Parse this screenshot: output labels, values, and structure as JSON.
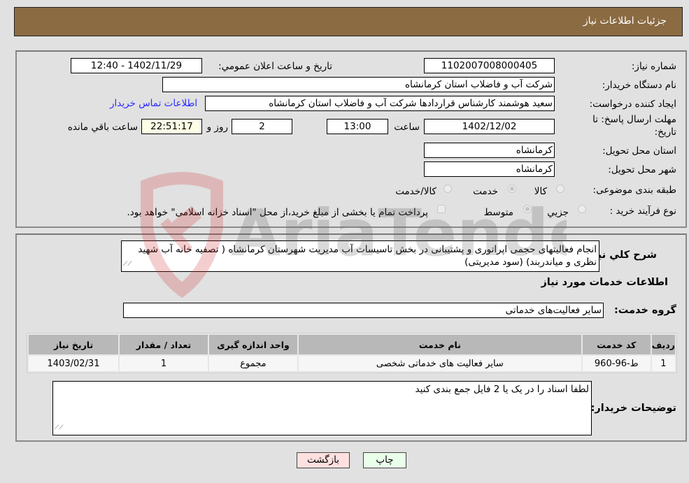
{
  "header": {
    "title": "جزئیات اطلاعات نیاز"
  },
  "details": {
    "need_number_label": "شماره نیاز:",
    "need_number": "1102007008000405",
    "announce_label": "تاریخ و ساعت اعلان عمومي:",
    "announce_value": "1402/11/29 - 12:40",
    "buyer_org_label": "نام دستگاه خريدار:",
    "buyer_org": "شرکت آب و فاضلاب استان کرمانشاه",
    "creator_label": "ایجاد کننده درخواست:",
    "creator": "سعید هوشمند کارشناس قراردادها شرکت آب و فاضلاب استان کرمانشاه",
    "contact_link": "اطلاعات تماس خریدار",
    "deadline_label_line1": "مهلت ارسال پاسخ: تا",
    "deadline_label_line2": "تاریخ:",
    "deadline_date": "1402/12/02",
    "time_label": "ساعت",
    "deadline_time": "13:00",
    "days_value": "2",
    "days_label": "روز و",
    "remaining_time": "22:51:17",
    "remaining_label": "ساعت باقي مانده",
    "province_label": "استان محل تحویل:",
    "province": "کرمانشاه",
    "city_label": "شهر محل تحویل:",
    "city": "کرمانشاه",
    "category_label": "طبقه بندی موضوعی:",
    "category_options": [
      {
        "label": "کالا",
        "selected": false
      },
      {
        "label": "خدمت",
        "selected": true
      },
      {
        "label": "کالا/خدمت",
        "selected": false
      }
    ],
    "process_label": "نوع فرآیند خرید :",
    "process_options": [
      {
        "label": "جزيي",
        "selected": false
      },
      {
        "label": "متوسط",
        "selected": true
      }
    ],
    "treasury_checkbox_label": "پرداخت تمام یا بخشی از مبلغ خرید،از محل \"اسناد خزانه اسلامی\" خواهد بود.",
    "treasury_checked": false
  },
  "summary": {
    "description_label": "شرح کلي نياز:",
    "description": "انجام فعالیتهای حجمی اپراتوری و پشتیبانی در بخش تاسیسات آب مدیریت شهرستان کرمانشاه ( تصفیه خانه آب شهید نظری و میاندربند) (سود مدیریتی)",
    "services_heading": "اطلاعات خدمات مورد نياز",
    "service_group_label": "گروه خدمت:",
    "service_group": "سایر فعالیت‌های خدماتی",
    "table": {
      "headers": [
        "ردیف",
        "کد خدمت",
        "نام خدمت",
        "واحد اندازه گیری",
        "تعداد / مقدار",
        "تاریخ نیاز"
      ],
      "rows": [
        [
          "1",
          "ط-96-960",
          "سایر فعالیت های خدماتی شخصی",
          "مجموع",
          "1",
          "1403/02/31"
        ]
      ]
    },
    "buyer_notes_label": "توضیحات خریدار:",
    "buyer_notes": "لطفا اسناد را در یک یا 2 فایل جمع بندی کنید"
  },
  "buttons": {
    "print": "چاپ",
    "back": "بازگشت"
  },
  "watermark": {
    "text": "AriaTender.neT"
  },
  "colors": {
    "header": "#8b6b42",
    "print_button": "#eaffea",
    "back_button": "#ffe0e0",
    "link": "#2a2aff"
  }
}
